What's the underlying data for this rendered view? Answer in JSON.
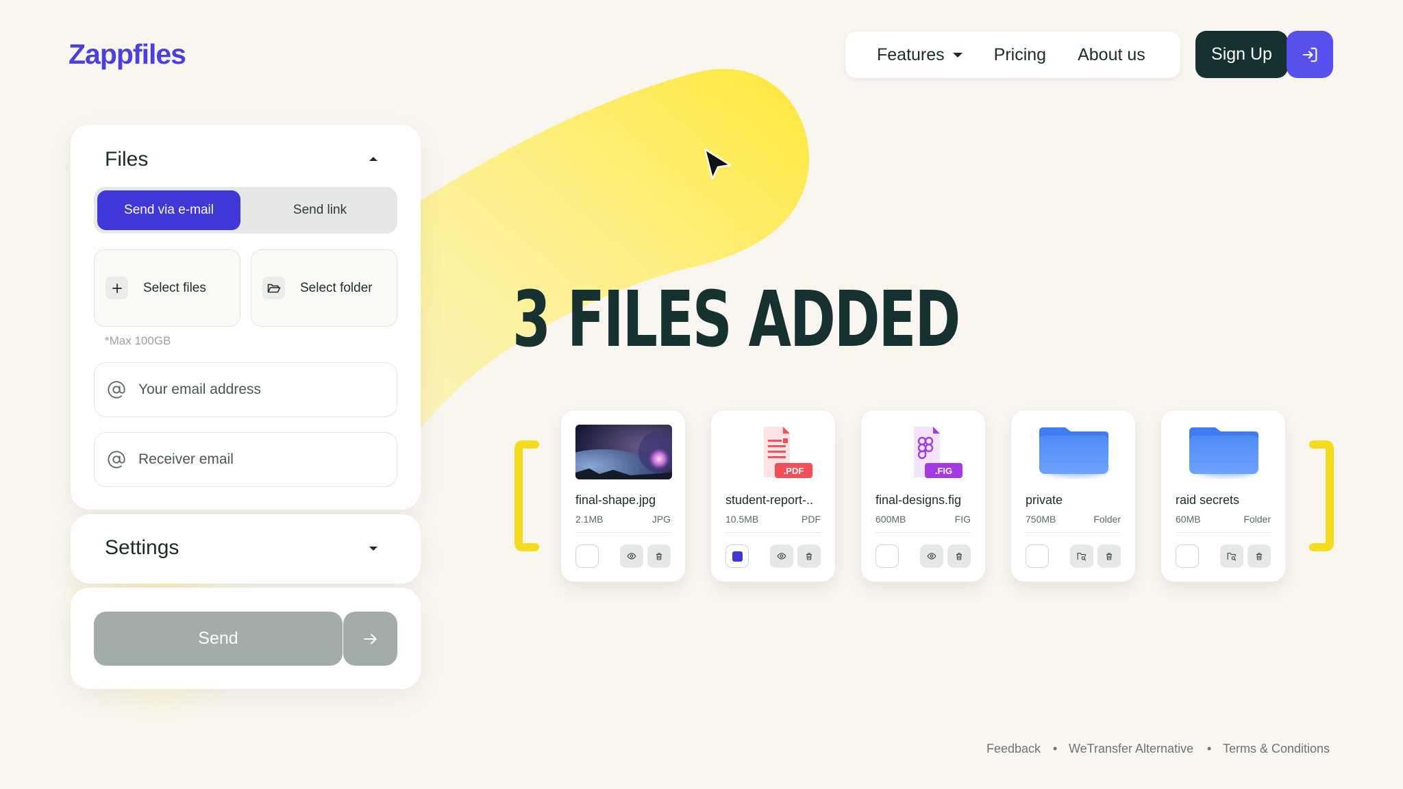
{
  "brand": {
    "logo": "Zappfiles"
  },
  "nav": {
    "features": "Features",
    "pricing": "Pricing",
    "about": "About us",
    "signup": "Sign Up"
  },
  "files_panel": {
    "title": "Files",
    "tabs": {
      "email": "Send via e-mail",
      "link": "Send link"
    },
    "select_files": "Select files",
    "select_folder": "Select folder",
    "max_hint": "*Max 100GB",
    "your_email_placeholder": "Your email address",
    "receiver_email_placeholder": "Receiver email"
  },
  "settings_panel": {
    "title": "Settings"
  },
  "send_panel": {
    "send_label": "Send"
  },
  "headline": "3 FILES ADDED",
  "files": [
    {
      "name": "final-shape.jpg",
      "size": "2.1MB",
      "type": "JPG",
      "checked": false,
      "icon": "image-thumbnail"
    },
    {
      "name": "student-report-..",
      "size": "10.5MB",
      "type": "PDF",
      "checked": true,
      "icon": "pdf-file-icon",
      "badge": ".PDF"
    },
    {
      "name": "final-designs.fig",
      "size": "600MB",
      "type": "FIG",
      "checked": false,
      "icon": "figma-file-icon",
      "badge": ".FIG"
    },
    {
      "name": "private",
      "size": "750MB",
      "type": "Folder",
      "checked": false,
      "icon": "folder-icon"
    },
    {
      "name": "raid secrets",
      "size": "60MB",
      "type": "Folder",
      "checked": false,
      "icon": "folder-icon"
    }
  ],
  "footer": {
    "feedback": "Feedback",
    "alternative": "WeTransfer Alternative",
    "terms": "Terms & Conditions"
  },
  "colors": {
    "background": "#f8f6ef",
    "brand": "#4a3fe0",
    "accent": "#3f37d6",
    "dark": "#173030",
    "yellow": "#fde84a",
    "send_disabled": "#a2acab"
  }
}
